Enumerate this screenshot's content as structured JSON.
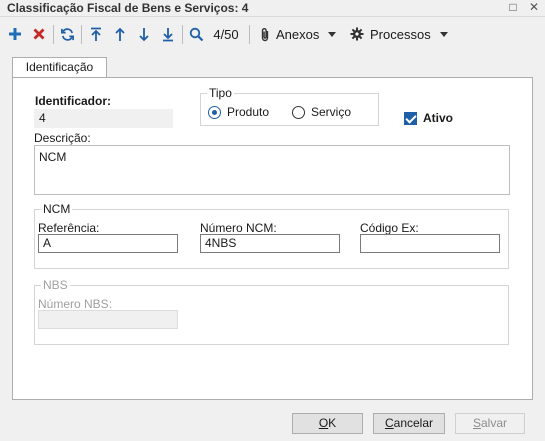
{
  "window": {
    "title": "Classificação Fiscal de Bens e Serviços: 4",
    "restore_glyph": "□",
    "close_glyph": "✕"
  },
  "toolbar": {
    "record_counter": "4/50",
    "anexos_label": "Anexos",
    "processos_label": "Processos",
    "icons": [
      "add-icon",
      "delete-icon",
      "refresh-icon",
      "first-icon",
      "previous-icon",
      "next-icon",
      "last-icon",
      "search-icon",
      "paperclip-icon",
      "gear-icon"
    ],
    "colors": {
      "add": "#1f6fb8",
      "delete": "#c62828",
      "nav": "#1f5fa8"
    }
  },
  "tabs": [
    {
      "label": "Identificação",
      "active": true
    }
  ],
  "form": {
    "identificador": {
      "label": "Identificador:",
      "value": "4"
    },
    "tipo": {
      "legend": "Tipo",
      "options": [
        {
          "label": "Produto",
          "selected": true
        },
        {
          "label": "Serviço",
          "selected": false
        }
      ]
    },
    "ativo": {
      "label": "Ativo",
      "checked": true
    },
    "descricao": {
      "label": "Descrição:",
      "value": "NCM"
    },
    "ncm": {
      "legend": "NCM",
      "referencia": {
        "label": "Referência:",
        "value": "A"
      },
      "numero": {
        "label": "Número NCM:",
        "value": "4NBS"
      },
      "codigo_ex": {
        "label": "Código Ex:",
        "value": ""
      }
    },
    "nbs": {
      "legend": "NBS",
      "numero": {
        "label": "Número NBS:",
        "value": ""
      }
    }
  },
  "buttons": {
    "ok": {
      "prefix": "",
      "underlined": "O",
      "rest": "K"
    },
    "cancelar": {
      "prefix": "",
      "underlined": "C",
      "rest": "ancelar"
    },
    "salvar": {
      "prefix": "",
      "underlined": "S",
      "rest": "alvar"
    }
  }
}
